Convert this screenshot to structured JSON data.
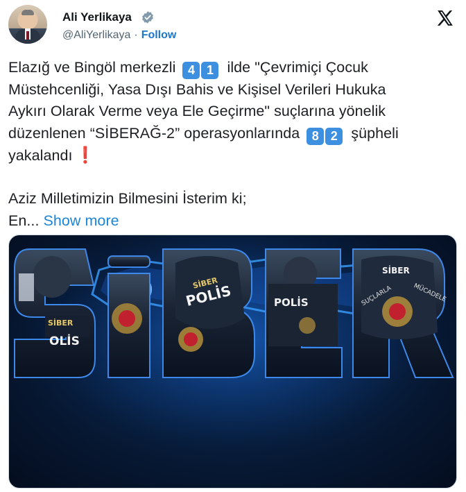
{
  "author": {
    "name": "Ali Yerlikaya",
    "handle": "@AliYerlikaya",
    "separator": "·",
    "follow_label": "Follow",
    "avatar_icon": "profile-photo-avatar",
    "verified_icon": "verified-badge-icon",
    "verified_color": "#829aab"
  },
  "platform": {
    "logo_icon": "x-logo-icon"
  },
  "tweet": {
    "l1_a": "Elazığ ve Bingöl merkezli",
    "kc_4": "4",
    "kc_1": "1",
    "l1_b": "ilde \"Çevrimiçi Çocuk",
    "l2": "Müstehcenliği, Yasa Dışı Bahis ve Kişisel Verileri Hukuka",
    "l3": "Aykırı Olarak Verme veya Ele Geçirme\" suçlarına yönelik",
    "l4_a": "düzenlenen “SİBERAĞ-2” operasyonlarında",
    "kc_8": "8",
    "kc_2": "2",
    "l4_b": "şüpheli",
    "l5": "yakalandı",
    "exclamation": "❗",
    "l7": "Aziz Milletimizin Bilmesini İsterim ki;",
    "l8": "En...",
    "show_more": "Show more"
  },
  "media": {
    "overlay_word": "SİBER",
    "patch_text": "POLİS",
    "badge_text": "SİBER",
    "accent_color": "#2f8fff",
    "link_color": "#1d76c9"
  }
}
